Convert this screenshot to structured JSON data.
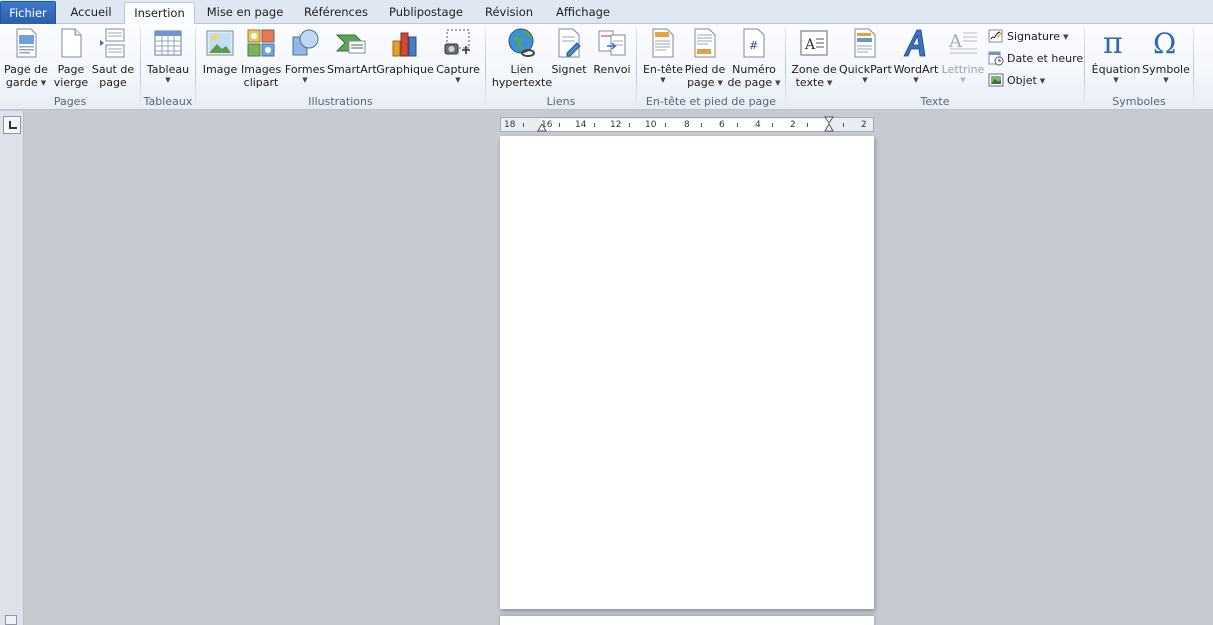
{
  "tabs": [
    {
      "label": "Fichier",
      "key": "file"
    },
    {
      "label": "Accueil",
      "key": "home"
    },
    {
      "label": "Insertion",
      "key": "insert",
      "active": true
    },
    {
      "label": "Mise en page",
      "key": "layout"
    },
    {
      "label": "Références",
      "key": "references"
    },
    {
      "label": "Publipostage",
      "key": "mailings"
    },
    {
      "label": "Révision",
      "key": "review"
    },
    {
      "label": "Affichage",
      "key": "view"
    }
  ],
  "groups": {
    "pages": {
      "label": "Pages",
      "cover_l1": "Page de",
      "cover_l2": "garde",
      "blank_l1": "Page",
      "blank_l2": "vierge",
      "break_l1": "Saut de",
      "break_l2": "page"
    },
    "tables": {
      "label": "Tableaux",
      "table": "Tableau"
    },
    "illustrations": {
      "label": "Illustrations",
      "image": "Image",
      "clipart_l1": "Images",
      "clipart_l2": "clipart",
      "shapes": "Formes",
      "smartart": "SmartArt",
      "chart": "Graphique",
      "capture": "Capture"
    },
    "links": {
      "label": "Liens",
      "hyperlink_l1": "Lien",
      "hyperlink_l2": "hypertexte",
      "bookmark": "Signet",
      "crossref": "Renvoi"
    },
    "headerfooter": {
      "label": "En-tête et pied de page",
      "header": "En-tête",
      "footer_l1": "Pied de",
      "footer_l2": "page",
      "pagenum_l1": "Numéro",
      "pagenum_l2": "de page"
    },
    "text": {
      "label": "Texte",
      "textbox_l1": "Zone de",
      "textbox_l2": "texte",
      "quickpart": "QuickPart",
      "wordart": "WordArt",
      "dropcap": "Lettrine",
      "signature": "Signature",
      "datetime": "Date et heure",
      "object": "Objet"
    },
    "symbols": {
      "label": "Symboles",
      "equation": "Équation",
      "symbol": "Symbole"
    }
  },
  "ruler": {
    "numbers": [
      "18",
      "16",
      "14",
      "12",
      "10",
      "8",
      "6",
      "4",
      "2",
      "2"
    ]
  },
  "colors": {
    "accent": "#2a5fae",
    "ribbon_bg": "#f3f6fb",
    "workspace_bg": "#c6cad1"
  }
}
